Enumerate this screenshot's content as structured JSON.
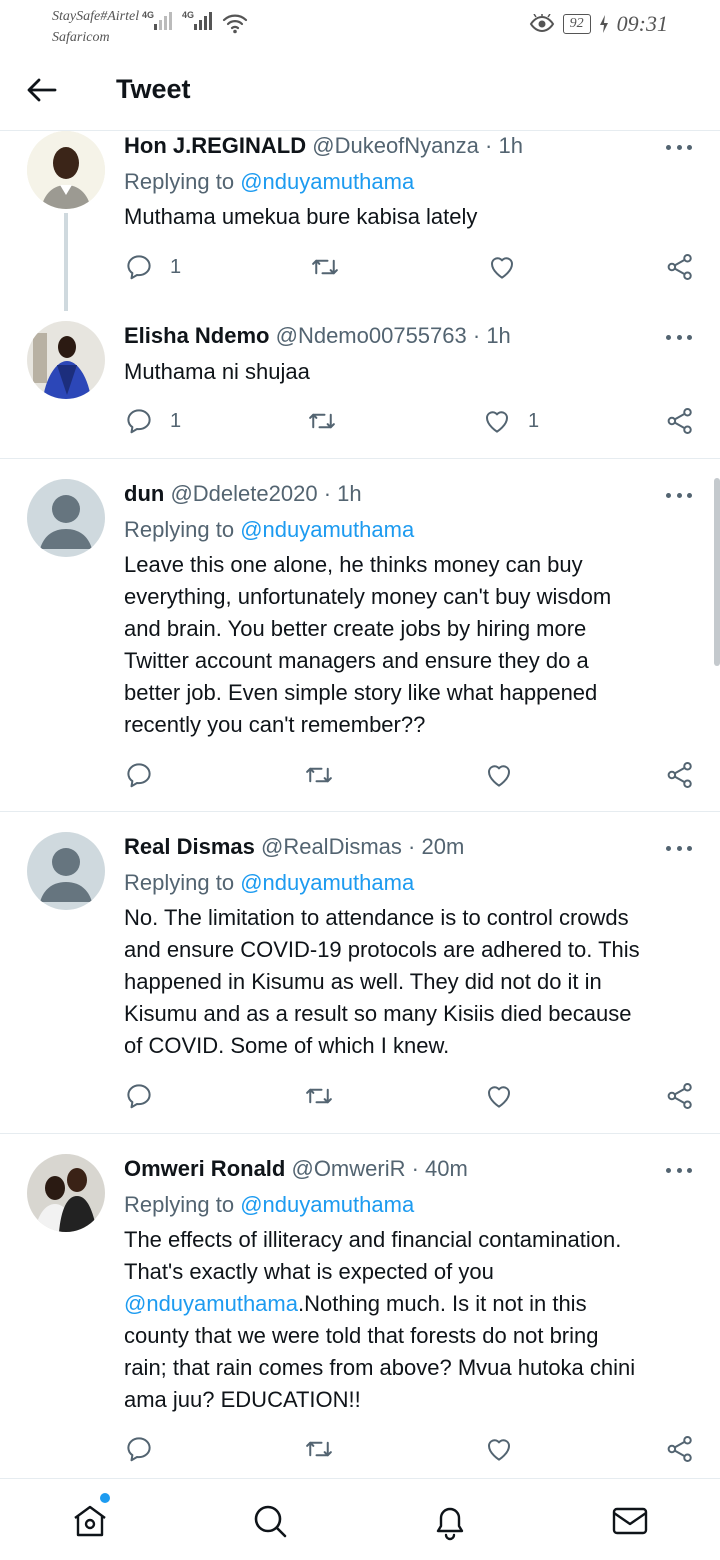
{
  "status_bar": {
    "carrier_1": "StaySafe#Airtel",
    "carrier_2": "Safaricom",
    "network_1": "4G",
    "network_2": "4G",
    "battery": "92",
    "time": "09:31"
  },
  "header": {
    "title": "Tweet"
  },
  "tweets": [
    {
      "name": "Hon J.REGINALD",
      "handle": "@DukeofNyanza",
      "time": "· 1h",
      "replying_prefix": "Replying to",
      "replying_to": "@nduyamuthama",
      "text": "Muthama umekua bure kabisa lately",
      "reply_count": "1",
      "like_count": ""
    },
    {
      "name": "Elisha Ndemo",
      "handle": "@Ndemo00755763",
      "time": "· 1h",
      "text": "Muthama ni shujaa",
      "reply_count": "1",
      "like_count": "1"
    },
    {
      "name": "dun",
      "handle": "@Ddelete2020",
      "time": "· 1h",
      "replying_prefix": "Replying to",
      "replying_to": "@nduyamuthama",
      "text_lines": [
        "Leave this one alone, he thinks money can buy",
        "everything, unfortunately money can't buy wisdom",
        "and brain. You better create jobs by hiring more",
        "Twitter account managers and ensure they do a",
        "better job. Even simple story like what happened",
        "recently you can't remember??"
      ]
    },
    {
      "name": "Real Dismas",
      "handle": "@RealDismas",
      "time": "· 20m",
      "replying_prefix": "Replying to",
      "replying_to": "@nduyamuthama",
      "text_lines": [
        "No. The limitation to attendance is to control crowds",
        "and ensure COVID-19 protocols are adhered to. This",
        "happened in Kisumu as well. They did not do it in",
        "Kisumu and as a result so many Kisiis died because",
        "of COVID. Some of which I knew."
      ]
    },
    {
      "name": "Omweri Ronald",
      "handle": "@OmweriR",
      "time": "· 40m",
      "replying_prefix": "Replying to",
      "replying_to": "@nduyamuthama",
      "text_line_1": "The effects of illiteracy and financial contamination.",
      "text_line_2": "That's exactly what is expected of you",
      "text_mention": "@nduyamuthama",
      "text_line_3_rest": ".Nothing much. Is it not in this",
      "text_line_4": "county that we were told that forests do not bring",
      "text_line_5": "rain; that rain comes from above? Mvua hutoka chini",
      "text_line_6": "ama juu? EDUCATION!!"
    }
  ],
  "icons": {
    "back": "arrow-left-icon",
    "more": "more-dots-icon",
    "reply": "comment-icon",
    "retweet": "retweet-icon",
    "like": "heart-icon",
    "share": "share-icon",
    "home": "home-icon",
    "search": "search-icon",
    "notifications": "bell-icon",
    "messages": "mail-icon"
  },
  "colors": {
    "accent": "#1d9bf0",
    "secondary_text": "#536471",
    "divider": "#e6ecf0"
  }
}
